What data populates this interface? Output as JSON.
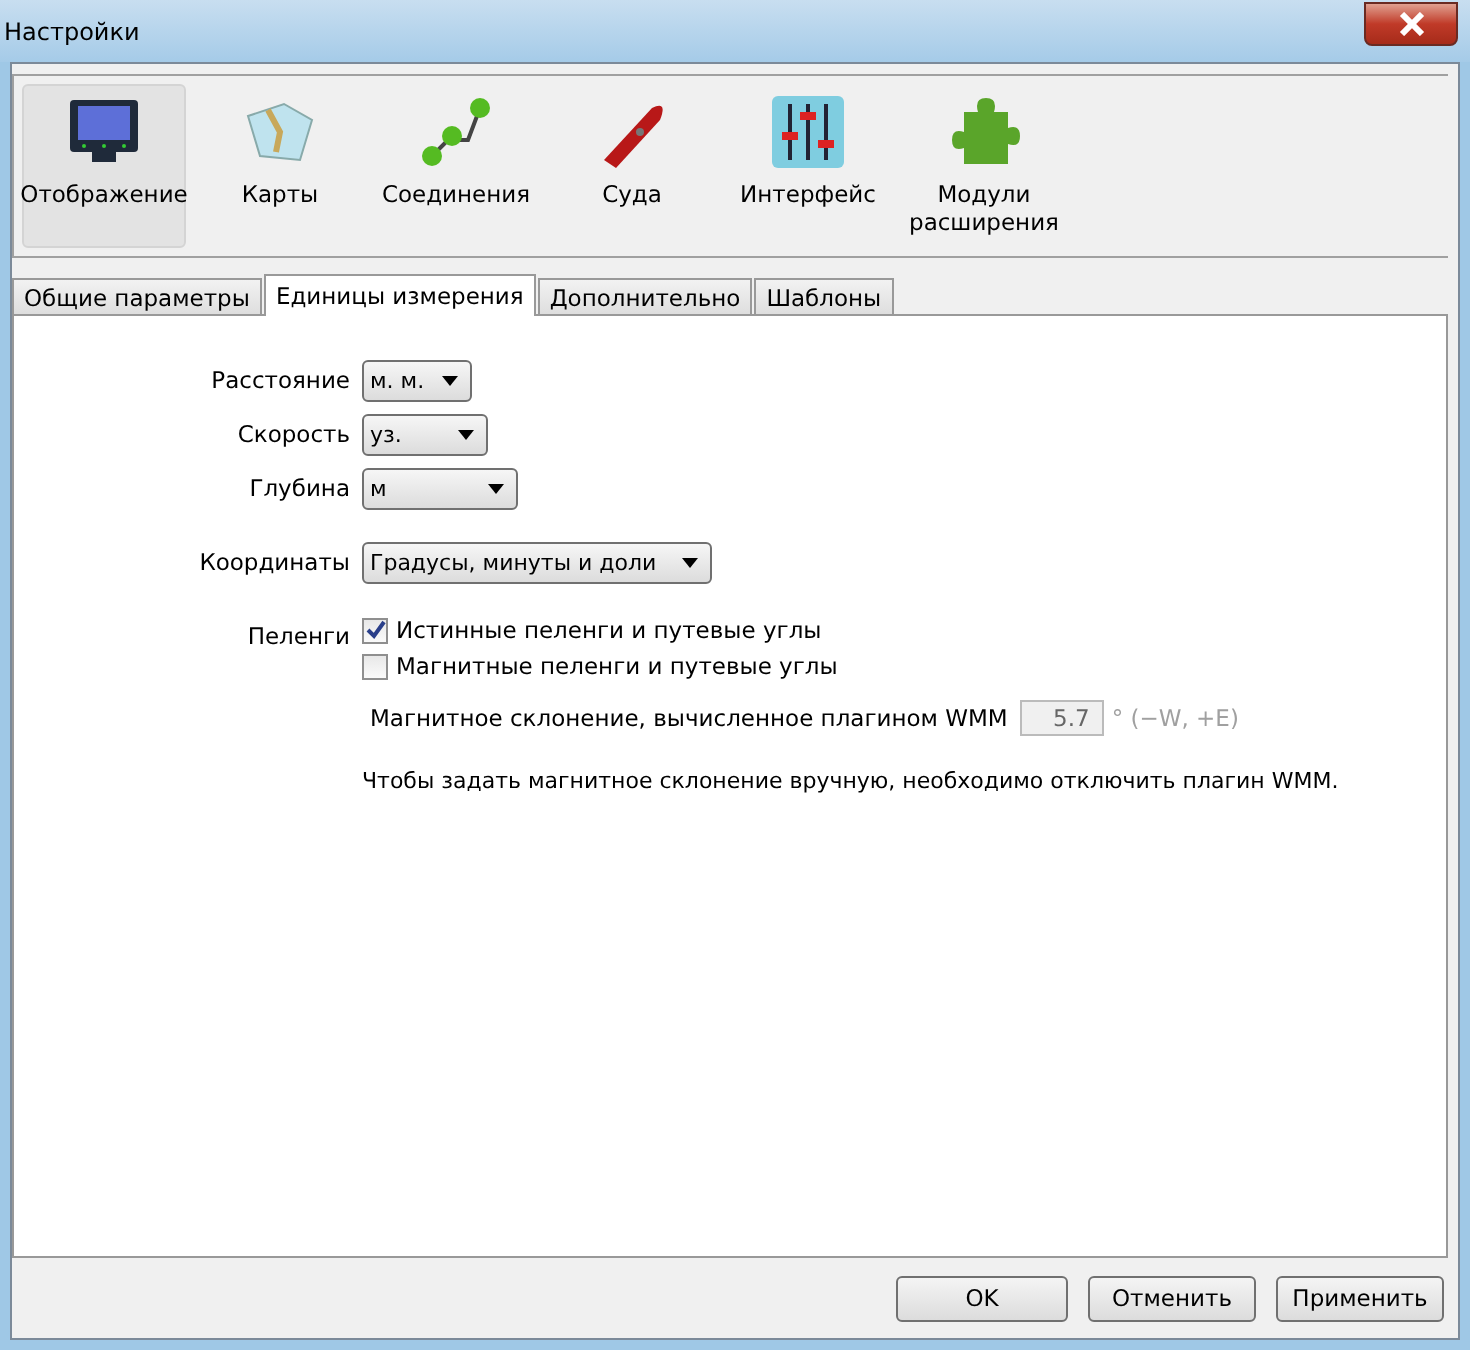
{
  "window": {
    "title": "Настройки"
  },
  "categories": [
    {
      "label": "Отображение",
      "kind": "monitor",
      "selected": true
    },
    {
      "label": "Карты",
      "kind": "map",
      "selected": false
    },
    {
      "label": "Соединения",
      "kind": "connections",
      "selected": false
    },
    {
      "label": "Суда",
      "kind": "boat",
      "selected": false
    },
    {
      "label": "Интерфейс",
      "kind": "sliders",
      "selected": false
    },
    {
      "label": "Модули расширения",
      "kind": "puzzle",
      "selected": false
    }
  ],
  "tabs": [
    {
      "label": "Общие параметры",
      "selected": false
    },
    {
      "label": "Единицы измерения",
      "selected": true
    },
    {
      "label": "Дополнительно",
      "selected": false
    },
    {
      "label": "Шаблоны",
      "selected": false
    }
  ],
  "units": [
    {
      "label": "Расстояние",
      "value": "м. м."
    },
    {
      "label": "Скорость",
      "value": "уз."
    },
    {
      "label": "Глубина",
      "value": "м"
    }
  ],
  "coordinates": {
    "label": "Координаты",
    "value": "Градусы, минуты и доли"
  },
  "bearings": {
    "label": "Пеленги",
    "options": [
      {
        "label": "Истинные пеленги и путевые углы",
        "checked": true
      },
      {
        "label": "Магнитные пеленги и путевые углы",
        "checked": false
      }
    ]
  },
  "declination": {
    "label": "Магнитное склонение, вычисленное плагином WMM",
    "value": "5.7",
    "disabled": true,
    "unit": "° (−W, +E)"
  },
  "note": "Чтобы задать магнитное склонение вручную, необходимо отключить плагин WMM.",
  "buttons": [
    "OK",
    "Отменить",
    "Применить"
  ]
}
